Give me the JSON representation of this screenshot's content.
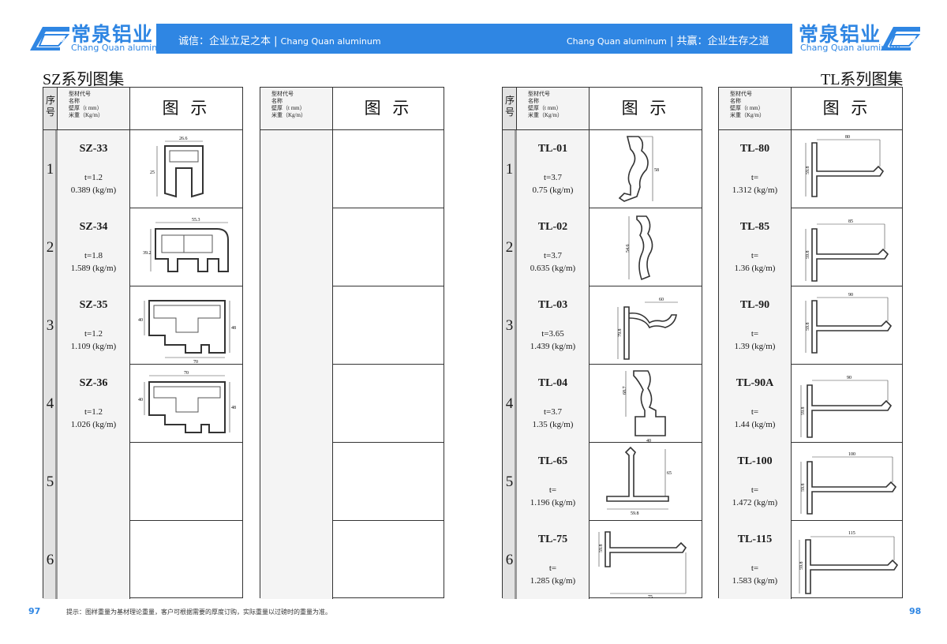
{
  "brand": {
    "name_cn": "常泉铝业",
    "name_en": "Chang Quan aluminum",
    "logo_badge": "常泉"
  },
  "banner": {
    "left_slogan": "诚信：企业立足之本",
    "left_en": "Chang Quan aluminum",
    "right_en": "Chang Quan aluminum",
    "right_slogan": "共赢：企业生存之道"
  },
  "left_page": {
    "series_title": "SZ系列图集",
    "page_number": "97",
    "header": {
      "seq_label": "序号",
      "code_label_lines": [
        "型材代号",
        "名称",
        "壁厚（t mm）",
        "米重（Kg/m）"
      ],
      "figure_label": "图 示"
    },
    "items": [
      {
        "seq": "1",
        "code": "SZ-33",
        "thickness": "t=1.2",
        "weight": "0.389 (kg/m)",
        "dims": [
          "26.6",
          "25"
        ]
      },
      {
        "seq": "2",
        "code": "SZ-34",
        "thickness": "t=1.8",
        "weight": "1.589 (kg/m)",
        "dims": [
          "55.3",
          "39.2"
        ]
      },
      {
        "seq": "3",
        "code": "SZ-35",
        "thickness": "t=1.2",
        "weight": "1.109 (kg/m)",
        "dims": [
          "40",
          "48",
          "70"
        ]
      },
      {
        "seq": "4",
        "code": "SZ-36",
        "thickness": "t=1.2",
        "weight": "1.026 (kg/m)",
        "dims": [
          "70",
          "40",
          "48"
        ]
      },
      {
        "seq": "5",
        "code": "",
        "thickness": "",
        "weight": "",
        "dims": []
      },
      {
        "seq": "6",
        "code": "",
        "thickness": "",
        "weight": "",
        "dims": []
      }
    ]
  },
  "right_page": {
    "series_title": "TL系列图集",
    "page_number": "98",
    "header": {
      "seq_label": "序号",
      "code_label_lines": [
        "型材代号",
        "名称",
        "壁厚（t mm）",
        "米重（Kg/m）"
      ],
      "figure_label": "图 示"
    },
    "items_a": [
      {
        "seq": "1",
        "code": "TL-01",
        "thickness": "t=3.7",
        "weight": "0.75 (kg/m)",
        "dims": [
          "58"
        ]
      },
      {
        "seq": "2",
        "code": "TL-02",
        "thickness": "t=3.7",
        "weight": "0.635 (kg/m)",
        "dims": [
          "54.6"
        ]
      },
      {
        "seq": "3",
        "code": "TL-03",
        "thickness": "t=3.65",
        "weight": "1.439 (kg/m)",
        "dims": [
          "60",
          "79.8"
        ]
      },
      {
        "seq": "4",
        "code": "TL-04",
        "thickness": "t=3.7",
        "weight": "1.35 (kg/m)",
        "dims": [
          "68.7",
          "40"
        ]
      },
      {
        "seq": "5",
        "code": "TL-65",
        "thickness": "t=",
        "weight": "1.196 (kg/m)",
        "dims": [
          "65",
          "59.8"
        ]
      },
      {
        "seq": "6",
        "code": "TL-75",
        "thickness": "t=",
        "weight": "1.285 (kg/m)",
        "dims": [
          "59.8",
          "75"
        ]
      }
    ],
    "items_b": [
      {
        "code": "TL-80",
        "thickness": "t=",
        "weight": "1.312 (kg/m)",
        "dims": [
          "80",
          "59.8"
        ]
      },
      {
        "code": "TL-85",
        "thickness": "t=",
        "weight": "1.36 (kg/m)",
        "dims": [
          "85",
          "59.8"
        ]
      },
      {
        "code": "TL-90",
        "thickness": "t=",
        "weight": "1.39 (kg/m)",
        "dims": [
          "90",
          "59.8"
        ]
      },
      {
        "code": "TL-90A",
        "thickness": "t=",
        "weight": "1.44 (kg/m)",
        "dims": [
          "90",
          "59.8"
        ]
      },
      {
        "code": "TL-100",
        "thickness": "t=",
        "weight": "1.472 (kg/m)",
        "dims": [
          "100",
          "59.8"
        ]
      },
      {
        "code": "TL-115",
        "thickness": "t=",
        "weight": "1.583 (kg/m)",
        "dims": [
          "115",
          "59.8"
        ]
      }
    ]
  },
  "footer": {
    "note": "提示：图样重量为基材理论重量，客户可根据需要的厚度订购，实际重量以过磅时的重量为准。"
  },
  "colors": {
    "brand_blue": "#2f86e3",
    "seq_gray": "#e2e2e2",
    "code_bg": "#f4f4f4"
  }
}
